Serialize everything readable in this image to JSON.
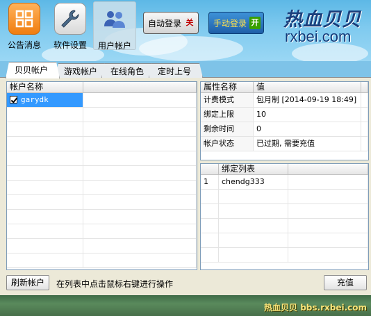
{
  "toolbar": {
    "items": [
      {
        "label": "公告消息",
        "icon": "announcement-icon"
      },
      {
        "label": "软件设置",
        "icon": "wrench-icon"
      },
      {
        "label": "用户帐户",
        "icon": "users-icon",
        "active": true
      }
    ]
  },
  "login_toggles": {
    "auto": {
      "label": "自动登录",
      "state": "关"
    },
    "manual": {
      "label": "手动登录",
      "state": "开"
    }
  },
  "brand": {
    "name": "热血贝贝",
    "url": "rxbei.com"
  },
  "tabs": [
    "贝贝帐户",
    "游戏帐户",
    "在线角色",
    "定时上号"
  ],
  "accounts": {
    "header": "帐户名称",
    "rows": [
      {
        "name": "garydk",
        "checked": true
      }
    ]
  },
  "properties": {
    "headers": [
      "属性名称",
      "值"
    ],
    "rows": [
      {
        "name": "计费模式",
        "value": "包月制 [2014-09-19 18:49]"
      },
      {
        "name": "绑定上限",
        "value": "10"
      },
      {
        "name": "剩余时间",
        "value": "0"
      },
      {
        "name": "帐户状态",
        "value": "已过期, 需要充值"
      }
    ]
  },
  "bindings": {
    "header": "绑定列表",
    "rows": [
      {
        "index": "1",
        "name": "chendg333"
      }
    ]
  },
  "footer": {
    "refresh_label": "刷新帐户",
    "hint": "在列表中点击鼠标右键进行操作",
    "recharge_label": "充值"
  },
  "watermark": "热血贝贝 bbs.rxbei.com",
  "colors": {
    "selection": "#3399ff",
    "grid_border": "#7f9db9",
    "toggle_off": "#c00000",
    "toggle_on": "#2a8a00"
  }
}
